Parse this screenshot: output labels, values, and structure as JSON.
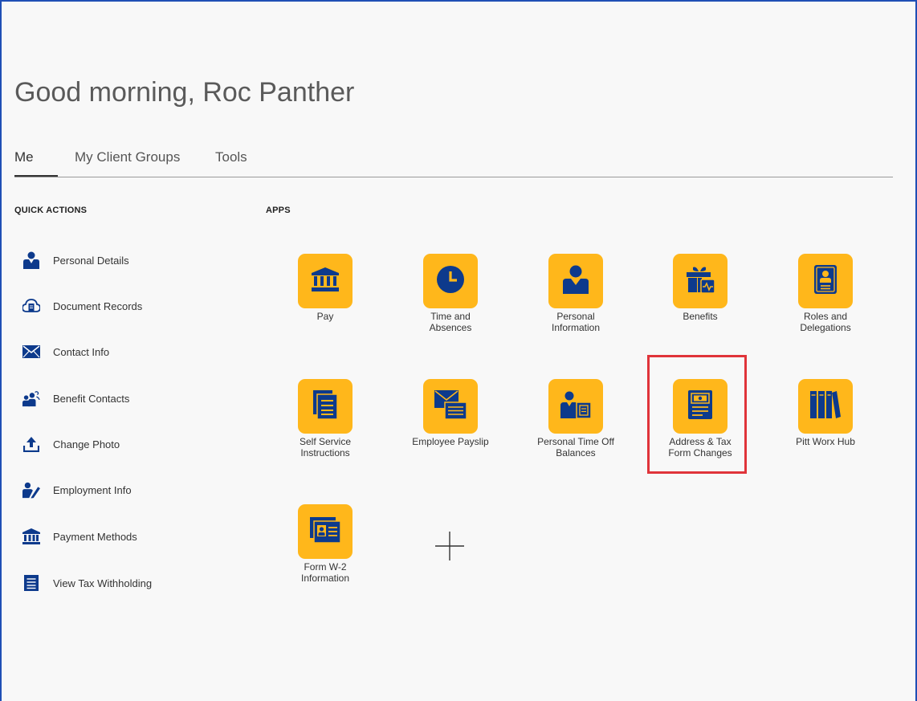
{
  "greeting": "Good morning, Roc Panther",
  "tabs": [
    {
      "label": "Me"
    },
    {
      "label": "My Client Groups"
    },
    {
      "label": "Tools"
    }
  ],
  "quick_actions": {
    "heading": "QUICK ACTIONS",
    "items": [
      {
        "label": "Personal Details",
        "icon": "person-icon"
      },
      {
        "label": "Document Records",
        "icon": "cloud-document-icon"
      },
      {
        "label": "Contact Info",
        "icon": "envelope-icon"
      },
      {
        "label": "Benefit Contacts",
        "icon": "family-icon"
      },
      {
        "label": "Change Photo",
        "icon": "upload-icon"
      },
      {
        "label": "Employment Info",
        "icon": "person-edit-icon"
      },
      {
        "label": "Payment Methods",
        "icon": "bank-icon"
      },
      {
        "label": "View Tax Withholding",
        "icon": "document-icon"
      }
    ]
  },
  "apps": {
    "heading": "APPS",
    "items": [
      {
        "label": "Pay",
        "icon": "bank-icon"
      },
      {
        "label": "Time and\nAbsences",
        "icon": "clock-icon"
      },
      {
        "label": "Personal\nInformation",
        "icon": "person-icon"
      },
      {
        "label": "Benefits",
        "icon": "gift-icon"
      },
      {
        "label": "Roles and\nDelegations",
        "icon": "badge-icon"
      },
      {
        "label": "Self Service\nInstructions",
        "icon": "pages-icon"
      },
      {
        "label": "Employee Payslip",
        "icon": "payslip-icon"
      },
      {
        "label": "Personal Time Off\nBalances",
        "icon": "person-document-icon"
      },
      {
        "label": "Address & Tax\nForm Changes",
        "icon": "tax-form-icon"
      },
      {
        "label": "Pitt Worx Hub",
        "icon": "books-icon"
      },
      {
        "label": "Form W-2\nInformation",
        "icon": "id-card-icon"
      }
    ]
  },
  "colors": {
    "tile": "#ffb71b",
    "icon": "#0d3a8c",
    "highlight": "#e0343a"
  }
}
